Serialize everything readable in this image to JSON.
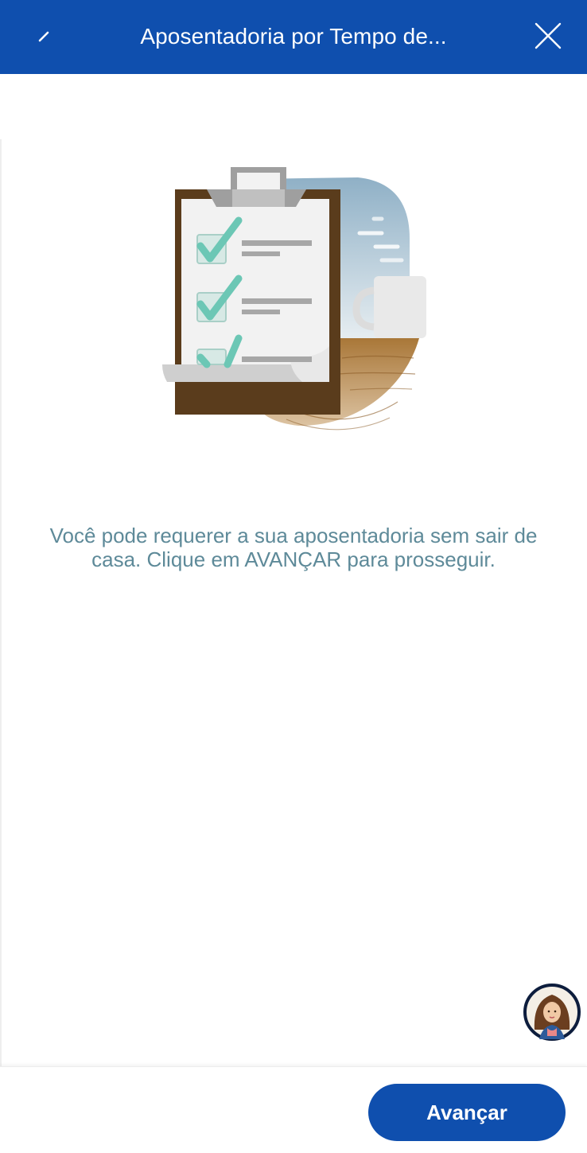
{
  "header": {
    "title": "Aposentadoria por Tempo de...",
    "back_icon": "back-arrow-icon",
    "close_icon": "close-icon",
    "background_color": "#0f4fae"
  },
  "main": {
    "illustration": "clipboard-checklist-coffee-illustration",
    "intro_text": "Você pode requerer a sua aposentadoria sem sair de casa. Clique em AVANÇAR para prosseguir.",
    "text_color": "#5e8a99"
  },
  "assistant": {
    "avatar_icon": "virtual-assistant-avatar"
  },
  "footer": {
    "advance_label": "Avançar",
    "button_color": "#0f4fae"
  }
}
